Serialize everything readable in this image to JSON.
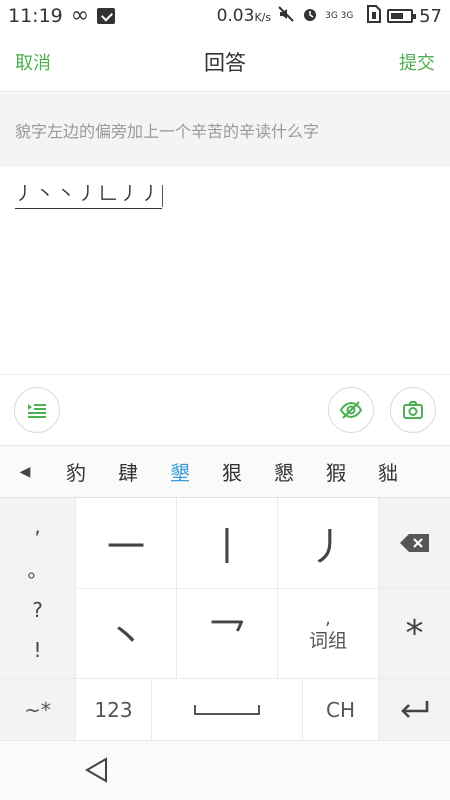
{
  "status_bar": {
    "time": "11:19",
    "infinity": "∞",
    "speed": "0.03",
    "speed_unit": "K/s",
    "signal_label": "3G 3G",
    "battery_level": "57"
  },
  "header": {
    "cancel": "取消",
    "title": "回答",
    "submit": "提交",
    "accent_color": "#4caf50"
  },
  "question": "貌字左边的偏旁加上一个辛苦的辛读什么字",
  "answer_text": "丿丶丶丿𠃊丿丿",
  "tools": {
    "list_icon": "list-icon",
    "eye_icon": "eye-off-icon",
    "camera_icon": "camera-icon"
  },
  "candidates": {
    "back_arrow": "◀",
    "items": [
      "豹",
      "肆",
      "墾",
      "狠",
      "懇",
      "猳",
      "貀"
    ],
    "active_index": 2,
    "active_color": "#3a9bd8"
  },
  "keyboard": {
    "punct": [
      ",",
      "。",
      "?",
      "!"
    ],
    "strokes": [
      "一",
      "丨",
      "丿",
      "丶",
      "乛"
    ],
    "word_group_comma": ",",
    "word_group": "词组",
    "star": "*",
    "bottom": {
      "symbols": "~*",
      "numbers": "123",
      "lang": "CH"
    }
  }
}
